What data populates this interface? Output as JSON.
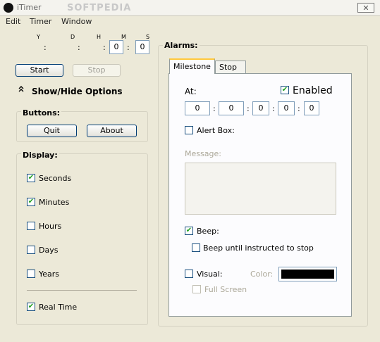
{
  "window": {
    "title": "iTimer",
    "watermark": "SOFTPEDIA",
    "close_label": "✕"
  },
  "menu": [
    "Edit",
    "Timer",
    "Window"
  ],
  "time_display": {
    "labels": [
      "Y",
      "D",
      "H",
      "M",
      "S"
    ],
    "minutes_value": "0",
    "seconds_value": "0"
  },
  "controls": {
    "start_label": "Start",
    "stop_label": "Stop",
    "toggle_options_label": "Show/Hide Options",
    "toggle_icon": "double-chevron-up-icon"
  },
  "buttons_group": {
    "heading": "Buttons:",
    "quit_label": "Quit",
    "about_label": "About"
  },
  "display_group": {
    "heading": "Display:",
    "items": [
      {
        "label": "Seconds",
        "checked": true
      },
      {
        "label": "Minutes",
        "checked": true
      },
      {
        "label": "Hours",
        "checked": false
      },
      {
        "label": "Days",
        "checked": false
      },
      {
        "label": "Years",
        "checked": false
      }
    ],
    "realtime": {
      "label": "Real Time",
      "checked": true
    }
  },
  "alarms": {
    "heading": "Alarms:",
    "tabs": [
      "Milestone",
      "Stop"
    ],
    "active_tab": "Milestone",
    "at_label": "At:",
    "enabled_label": "Enabled",
    "enabled_checked": true,
    "at_values": [
      "0",
      "0",
      "0",
      "0",
      "0"
    ],
    "alert_box_label": "Alert Box:",
    "message_label": "Message:",
    "message_value": "",
    "beep_label": "Beep:",
    "beep_checked": true,
    "beep_until_label": "Beep until instructed to stop",
    "visual_label": "Visual:",
    "color_label": "Color:",
    "color_value": "#000000",
    "fullscreen_label": "Full Screen"
  },
  "check_glyph": "✔"
}
